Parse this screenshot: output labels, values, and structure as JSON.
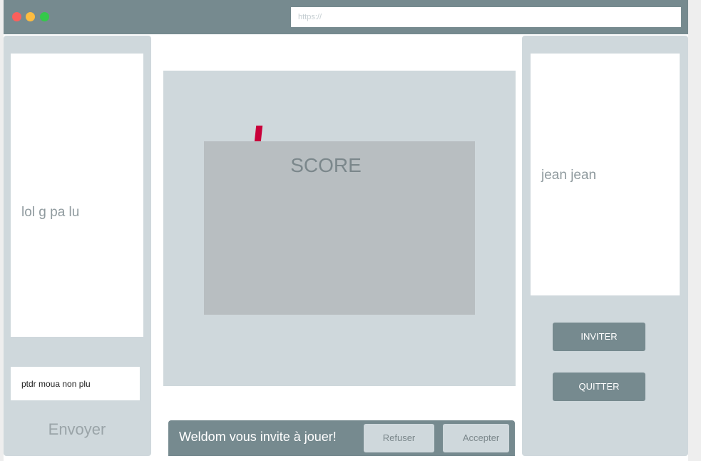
{
  "browser": {
    "url_placeholder": "https://"
  },
  "chat": {
    "messages": [
      "lol g pa lu"
    ],
    "input_value": "ptdr moua non plu",
    "send_label": "Envoyer"
  },
  "game": {
    "score_label": "SCORE"
  },
  "players": {
    "list": [
      "jean jean"
    ],
    "invite_label": "INVITER",
    "quit_label": "QUITTER"
  },
  "invitation": {
    "message": "Weldom vous invite à jouer!",
    "refuse_label": "Refuser",
    "accept_label": "Accepter"
  },
  "colors": {
    "titlebar": "#768a8f",
    "panel": "#cfd8dc",
    "score_board": "#b8bec1",
    "marker": "#c9003a"
  }
}
